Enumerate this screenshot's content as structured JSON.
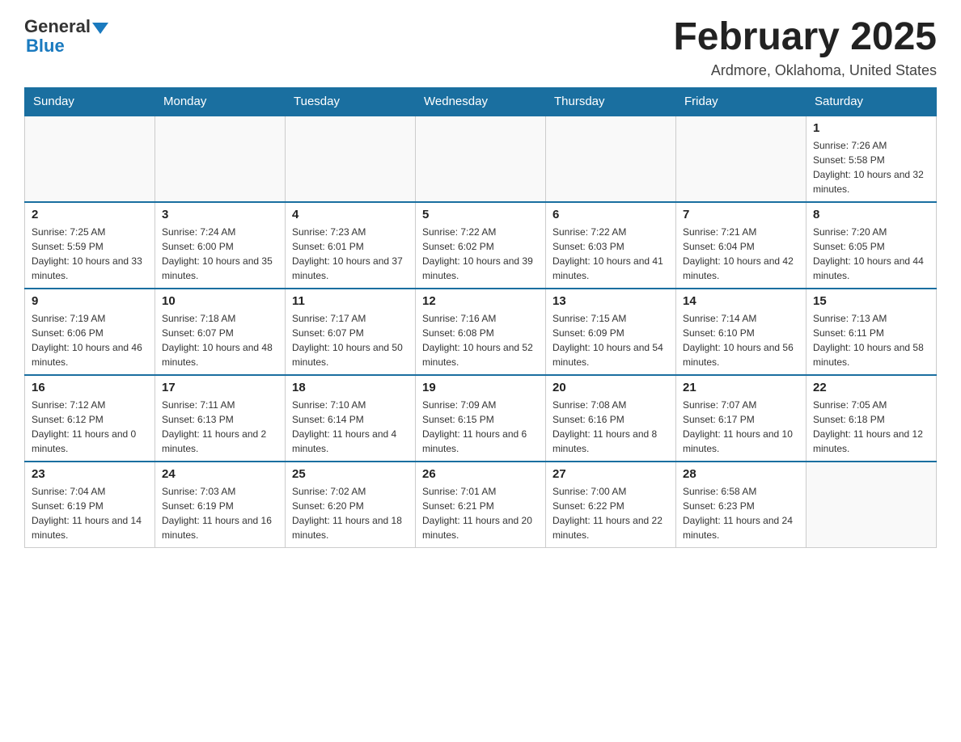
{
  "header": {
    "logo_general": "General",
    "logo_blue": "Blue",
    "month_title": "February 2025",
    "location": "Ardmore, Oklahoma, United States"
  },
  "days_of_week": [
    "Sunday",
    "Monday",
    "Tuesday",
    "Wednesday",
    "Thursday",
    "Friday",
    "Saturday"
  ],
  "weeks": [
    {
      "days": [
        {
          "date": "",
          "empty": true
        },
        {
          "date": "",
          "empty": true
        },
        {
          "date": "",
          "empty": true
        },
        {
          "date": "",
          "empty": true
        },
        {
          "date": "",
          "empty": true
        },
        {
          "date": "",
          "empty": true
        },
        {
          "date": "1",
          "sunrise": "Sunrise: 7:26 AM",
          "sunset": "Sunset: 5:58 PM",
          "daylight": "Daylight: 10 hours and 32 minutes."
        }
      ]
    },
    {
      "days": [
        {
          "date": "2",
          "sunrise": "Sunrise: 7:25 AM",
          "sunset": "Sunset: 5:59 PM",
          "daylight": "Daylight: 10 hours and 33 minutes."
        },
        {
          "date": "3",
          "sunrise": "Sunrise: 7:24 AM",
          "sunset": "Sunset: 6:00 PM",
          "daylight": "Daylight: 10 hours and 35 minutes."
        },
        {
          "date": "4",
          "sunrise": "Sunrise: 7:23 AM",
          "sunset": "Sunset: 6:01 PM",
          "daylight": "Daylight: 10 hours and 37 minutes."
        },
        {
          "date": "5",
          "sunrise": "Sunrise: 7:22 AM",
          "sunset": "Sunset: 6:02 PM",
          "daylight": "Daylight: 10 hours and 39 minutes."
        },
        {
          "date": "6",
          "sunrise": "Sunrise: 7:22 AM",
          "sunset": "Sunset: 6:03 PM",
          "daylight": "Daylight: 10 hours and 41 minutes."
        },
        {
          "date": "7",
          "sunrise": "Sunrise: 7:21 AM",
          "sunset": "Sunset: 6:04 PM",
          "daylight": "Daylight: 10 hours and 42 minutes."
        },
        {
          "date": "8",
          "sunrise": "Sunrise: 7:20 AM",
          "sunset": "Sunset: 6:05 PM",
          "daylight": "Daylight: 10 hours and 44 minutes."
        }
      ]
    },
    {
      "days": [
        {
          "date": "9",
          "sunrise": "Sunrise: 7:19 AM",
          "sunset": "Sunset: 6:06 PM",
          "daylight": "Daylight: 10 hours and 46 minutes."
        },
        {
          "date": "10",
          "sunrise": "Sunrise: 7:18 AM",
          "sunset": "Sunset: 6:07 PM",
          "daylight": "Daylight: 10 hours and 48 minutes."
        },
        {
          "date": "11",
          "sunrise": "Sunrise: 7:17 AM",
          "sunset": "Sunset: 6:07 PM",
          "daylight": "Daylight: 10 hours and 50 minutes."
        },
        {
          "date": "12",
          "sunrise": "Sunrise: 7:16 AM",
          "sunset": "Sunset: 6:08 PM",
          "daylight": "Daylight: 10 hours and 52 minutes."
        },
        {
          "date": "13",
          "sunrise": "Sunrise: 7:15 AM",
          "sunset": "Sunset: 6:09 PM",
          "daylight": "Daylight: 10 hours and 54 minutes."
        },
        {
          "date": "14",
          "sunrise": "Sunrise: 7:14 AM",
          "sunset": "Sunset: 6:10 PM",
          "daylight": "Daylight: 10 hours and 56 minutes."
        },
        {
          "date": "15",
          "sunrise": "Sunrise: 7:13 AM",
          "sunset": "Sunset: 6:11 PM",
          "daylight": "Daylight: 10 hours and 58 minutes."
        }
      ]
    },
    {
      "days": [
        {
          "date": "16",
          "sunrise": "Sunrise: 7:12 AM",
          "sunset": "Sunset: 6:12 PM",
          "daylight": "Daylight: 11 hours and 0 minutes."
        },
        {
          "date": "17",
          "sunrise": "Sunrise: 7:11 AM",
          "sunset": "Sunset: 6:13 PM",
          "daylight": "Daylight: 11 hours and 2 minutes."
        },
        {
          "date": "18",
          "sunrise": "Sunrise: 7:10 AM",
          "sunset": "Sunset: 6:14 PM",
          "daylight": "Daylight: 11 hours and 4 minutes."
        },
        {
          "date": "19",
          "sunrise": "Sunrise: 7:09 AM",
          "sunset": "Sunset: 6:15 PM",
          "daylight": "Daylight: 11 hours and 6 minutes."
        },
        {
          "date": "20",
          "sunrise": "Sunrise: 7:08 AM",
          "sunset": "Sunset: 6:16 PM",
          "daylight": "Daylight: 11 hours and 8 minutes."
        },
        {
          "date": "21",
          "sunrise": "Sunrise: 7:07 AM",
          "sunset": "Sunset: 6:17 PM",
          "daylight": "Daylight: 11 hours and 10 minutes."
        },
        {
          "date": "22",
          "sunrise": "Sunrise: 7:05 AM",
          "sunset": "Sunset: 6:18 PM",
          "daylight": "Daylight: 11 hours and 12 minutes."
        }
      ]
    },
    {
      "days": [
        {
          "date": "23",
          "sunrise": "Sunrise: 7:04 AM",
          "sunset": "Sunset: 6:19 PM",
          "daylight": "Daylight: 11 hours and 14 minutes."
        },
        {
          "date": "24",
          "sunrise": "Sunrise: 7:03 AM",
          "sunset": "Sunset: 6:19 PM",
          "daylight": "Daylight: 11 hours and 16 minutes."
        },
        {
          "date": "25",
          "sunrise": "Sunrise: 7:02 AM",
          "sunset": "Sunset: 6:20 PM",
          "daylight": "Daylight: 11 hours and 18 minutes."
        },
        {
          "date": "26",
          "sunrise": "Sunrise: 7:01 AM",
          "sunset": "Sunset: 6:21 PM",
          "daylight": "Daylight: 11 hours and 20 minutes."
        },
        {
          "date": "27",
          "sunrise": "Sunrise: 7:00 AM",
          "sunset": "Sunset: 6:22 PM",
          "daylight": "Daylight: 11 hours and 22 minutes."
        },
        {
          "date": "28",
          "sunrise": "Sunrise: 6:58 AM",
          "sunset": "Sunset: 6:23 PM",
          "daylight": "Daylight: 11 hours and 24 minutes."
        },
        {
          "date": "",
          "empty": true
        }
      ]
    }
  ]
}
